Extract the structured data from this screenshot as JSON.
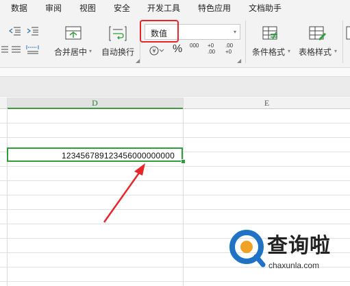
{
  "menu_tabs": [
    "数据",
    "审阅",
    "视图",
    "安全",
    "开发工具",
    "特色应用",
    "文档助手"
  ],
  "ribbon": {
    "merge_label": "合并居中",
    "wrap_label": "自动换行",
    "number_format_value": "数值",
    "percent_symbol": "%",
    "thousands_symbol": "000",
    "increase_decimal": "+0 .00",
    "decrease_decimal": ".00 +0",
    "conditional_format_label": "条件格式",
    "table_style_label": "表格样式"
  },
  "columns": {
    "d": "D",
    "e": "E"
  },
  "cell": {
    "value": "123456789123456000000000"
  },
  "watermark": {
    "brand": "查询啦",
    "url": "chaxunla.com"
  },
  "colors": {
    "highlight": "#e8262a",
    "selection": "#2e9e3a",
    "ribbon_bg": "#f3f3f3"
  }
}
